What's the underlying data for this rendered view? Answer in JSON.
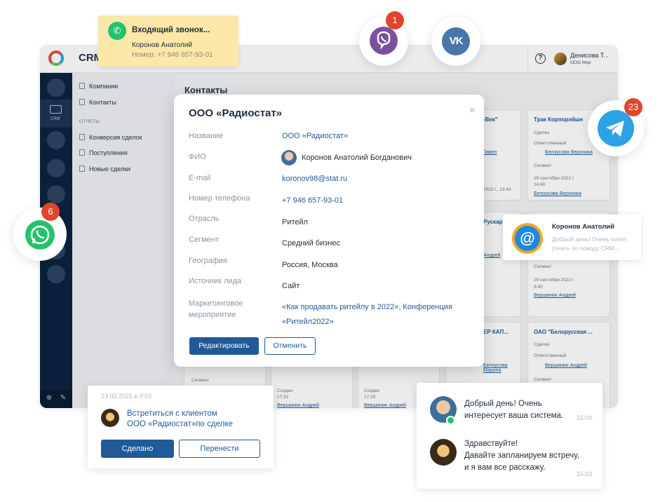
{
  "crm": {
    "title": "CRM",
    "rail_label": "CRM",
    "user_name": "Денисова Т.",
    "user_org": "ООО Мир",
    "help_glyph": "?",
    "nav": {
      "items": [
        "Компании",
        "Контакты"
      ],
      "section": "ОТЧЕТЫ",
      "reports": [
        "Конверсия сделок",
        "Поступления",
        "Новые сделки"
      ]
    },
    "page_title": "Контакты",
    "board": {
      "col_titles": [
        "-Век\"",
        "Трак Корпорэйшн",
        "Рускар",
        "ЕР КАП...",
        "ОАО \"Белорусская ..."
      ],
      "card": {
        "deal_label": "Сделка",
        "responsible_label": "Ответственный",
        "segment_label": "Сегмент",
        "created_label": "Создан",
        "person_1": "Белоусова Вероника",
        "person_2": "Вершинин Андрей",
        "person_3": "Белоусова Марина",
        "person_4": "Павел",
        "date_1": "29 сентября 2022 г.",
        "time_1": "14:40",
        "time_2": "9:40",
        "time_3": "17:32",
        "time_4": "17:28",
        "date_short": "2022 г., 23:44",
        "partial_1": "Андрей"
      }
    }
  },
  "modal": {
    "title": "ООО «Радиостат»",
    "close_glyph": "×",
    "fields": [
      {
        "label": "Название",
        "value": "ООО «Радиостат»"
      },
      {
        "label": "ФИО",
        "value": "Коронов Анатолий Богданович"
      },
      {
        "label": "E-mail",
        "value": "koronov98@stat.ru"
      },
      {
        "label": "Номер телефона",
        "value": "+7 946 657-93-01"
      },
      {
        "label": "Отрасль",
        "value": "Ритейл"
      },
      {
        "label": "Сегмент",
        "value": "Средний бизнес"
      },
      {
        "label": "География",
        "value": "Россия, Москва"
      },
      {
        "label": "Источник лида",
        "value": "Сайт"
      }
    ],
    "event_label_line1": "Маркетинговое",
    "event_label_line2": "мероприятие",
    "event_value_line1": "«Как продавать ритейлу в 2022», Конференция",
    "event_value_line2": "«Ритейл2022»",
    "edit_button": "Редактировать",
    "cancel_button": "Отменить"
  },
  "call": {
    "title": "Входящий звонок...",
    "name": "Коронов Анатолий",
    "number": "Номер: +7 946 657-93-01"
  },
  "messengers": {
    "viber_badge": "1",
    "vk_label": "VK",
    "telegram_badge": "23",
    "whatsapp_badge": "6"
  },
  "email": {
    "name": "Коронов Анатолий",
    "text": "Добрый день! Очень хотел узнать по поводу CRM...",
    "icon_glyph": "@"
  },
  "task": {
    "date": "23.02.2021 в 0:02",
    "text_line1": "Встретиться с клиентом",
    "text_line2": "ООО «Радиостат»по сделке",
    "done_button": "Сделано",
    "move_button": "Перенести"
  },
  "chat": {
    "messages": [
      {
        "line1": "Добрый день! Очень",
        "line2": "интересует ваша система.",
        "time": "15:00"
      },
      {
        "line1": "Здравствуйте!",
        "line2": "Давайте запланируем встречу,",
        "line3": "и я вам все расскажу.",
        "time": "15:02"
      }
    ]
  },
  "colors": {
    "brand_blue": "#1f5a99",
    "sidebar": "#0c2340",
    "call_bg": "#fbe8a8",
    "viber": "#7b519d",
    "vk": "#4a76a8",
    "telegram": "#2aa3e4",
    "whatsapp": "#25c26e",
    "badge": "#e0452b"
  }
}
